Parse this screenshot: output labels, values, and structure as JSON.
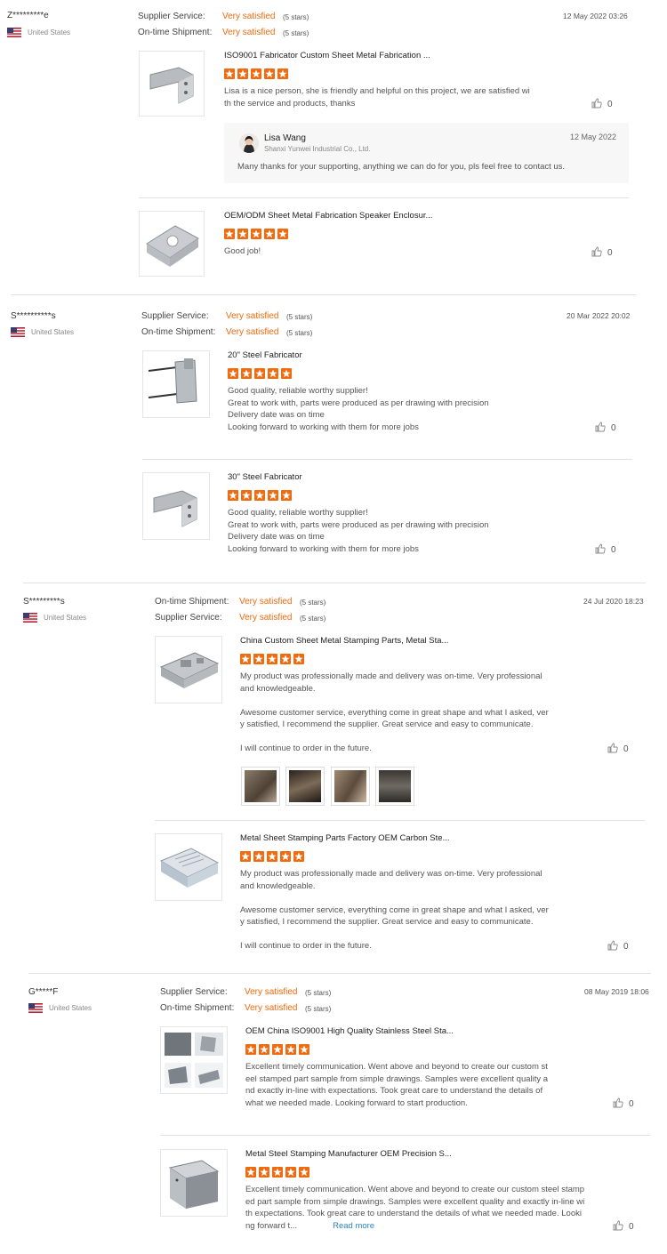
{
  "colors": {
    "accent": "#f06a0f",
    "link": "#2a86c9"
  },
  "reviews": [
    {
      "name": "Z*********e",
      "country": "United States",
      "rows": [
        {
          "label": "Supplier Service:",
          "value": "Very satisfied",
          "stars": "(5 stars)"
        },
        {
          "label": "On-time Shipment:",
          "value": "Very satisfied",
          "stars": "(5 stars)"
        }
      ],
      "date": "12 May 2022 03:26",
      "items": [
        {
          "title": "ISO9001 Fabricator Custom Sheet Metal Fabrication ...",
          "text": [
            "Lisa is a nice person, she is friendly and helpful on this project, we are satisfied wi",
            "th the service and products, thanks"
          ],
          "likes": "0",
          "reply": {
            "name": "Lisa Wang",
            "company": "Shanxi Yunwei Industrial Co., Ltd.",
            "date": "12 May 2022",
            "message": "Many thanks for your supporting, anything we can do for you, pls feel free to contact us."
          }
        },
        {
          "title": "OEM/ODM Sheet Metal Fabrication Speaker Enclosur...",
          "text": [
            "Good job!"
          ],
          "likes": "0"
        }
      ]
    },
    {
      "name": "S**********s",
      "country": "United States",
      "rows": [
        {
          "label": "Supplier Service:",
          "value": "Very satisfied",
          "stars": "(5 stars)"
        },
        {
          "label": "On-time Shipment:",
          "value": "Very satisfied",
          "stars": "(5 stars)"
        }
      ],
      "date": "20 Mar 2022 20:02",
      "items": [
        {
          "title": "20\" Steel Fabricator",
          "text": [
            "Good quality, reliable worthy supplier!",
            "Great to work with, parts were produced as per drawing with precision",
            "Delivery date was on time",
            "Looking forward to working with them for more jobs"
          ],
          "likes": "0"
        },
        {
          "title": "30\" Steel Fabricator",
          "text": [
            "Good quality, reliable worthy supplier!",
            "Great to work with, parts were produced as per drawing with precision",
            "Delivery date was on time",
            "Looking forward to working with them for more jobs"
          ],
          "likes": "0"
        }
      ]
    },
    {
      "name": "S*********s",
      "country": "United States",
      "rows": [
        {
          "label": "On-time Shipment:",
          "value": "Very satisfied",
          "stars": "(5 stars)"
        },
        {
          "label": "Supplier Service:",
          "value": "Very satisfied",
          "stars": "(5 stars)"
        }
      ],
      "date": "24 Jul 2020 18:23",
      "items": [
        {
          "title": "China Custom Sheet Metal Stamping Parts, Metal Sta...",
          "text": [
            "My product was professionally made and delivery was on-time. Very professional",
            "and knowledgeable.",
            "",
            "Awesome customer service, everything come in great shape and what I asked, ver",
            "y satisfied, I recommend the supplier. Great service and easy to communicate.",
            "",
            "I will continue to order in the future."
          ],
          "likes": "0",
          "photos": 4
        },
        {
          "title": "Metal Sheet Stamping Parts Factory OEM Carbon Ste...",
          "text": [
            "My product was professionally made and delivery was on-time. Very professional",
            "and knowledgeable.",
            "",
            "Awesome customer service, everything come in great shape and what I asked, ver",
            "y satisfied, I recommend the supplier. Great service and easy to communicate.",
            "",
            "I will continue to order in the future."
          ],
          "likes": "0"
        }
      ]
    },
    {
      "name": "G*****F",
      "country": "United States",
      "rows": [
        {
          "label": "Supplier Service:",
          "value": "Very satisfied",
          "stars": "(5 stars)"
        },
        {
          "label": "On-time Shipment:",
          "value": "Very satisfied",
          "stars": "(5 stars)"
        }
      ],
      "date": "08 May 2019 18:06",
      "items": [
        {
          "title": "OEM China ISO9001 High Quality Stainless Steel Sta...",
          "text": [
            "Excellent timely communication.  Went above and beyond to create our custom st",
            "eel stamped part sample from simple drawings.  Samples were excellent quality a",
            "nd exactly in-line with expectations.  Took great care to understand the details of",
            "what we needed made.  Looking forward to start production."
          ],
          "likes": "0"
        },
        {
          "title": "Metal Steel Stamping Manufacturer OEM Precision S...",
          "text": [
            "Excellent timely communication.  Went above and beyond to create our custom steel stamp",
            "ed part sample from simple drawings.  Samples were excellent quality and exactly in-line wi",
            "th expectations.  Took great care to understand the details of what we needed made.  Looki",
            "ng forward t..."
          ],
          "read_more": "Read more",
          "likes": "0"
        }
      ]
    }
  ]
}
